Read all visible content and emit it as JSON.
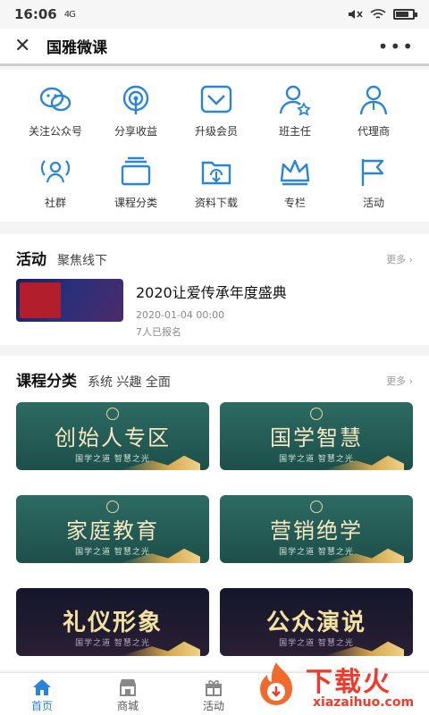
{
  "status": {
    "time": "16:06",
    "signal": "4G"
  },
  "navbar": {
    "title": "国雅微课"
  },
  "grid": [
    {
      "label": "关注公众号",
      "icon": "wechat-icon"
    },
    {
      "label": "分享收益",
      "icon": "broadcast-icon"
    },
    {
      "label": "升级会员",
      "icon": "diamond-icon"
    },
    {
      "label": "班主任",
      "icon": "user-star-icon"
    },
    {
      "label": "代理商",
      "icon": "user-icon"
    },
    {
      "label": "社群",
      "icon": "community-icon"
    },
    {
      "label": "课程分类",
      "icon": "layers-icon"
    },
    {
      "label": "资料下载",
      "icon": "cloud-download-icon"
    },
    {
      "label": "专栏",
      "icon": "crown-icon"
    },
    {
      "label": "活动",
      "icon": "flag-icon"
    }
  ],
  "activity": {
    "title": "活动",
    "subtitle": "聚焦线下",
    "more": "更多 ›",
    "event": {
      "title": "2020让爱传承年度盛典",
      "date": "2020-01-04 00:00",
      "count": "7人已报名"
    }
  },
  "courses": {
    "title": "课程分类",
    "subtitle": "系统 兴趣 全面",
    "more": "更多 ›",
    "cards": [
      {
        "name": "创始人专区",
        "tag": "国学之道 智慧之光",
        "style": "green"
      },
      {
        "name": "国学智慧",
        "tag": "国学之道 智慧之光",
        "style": "green"
      },
      {
        "name": "家庭教育",
        "tag": "国学之道 智慧之光",
        "style": "green"
      },
      {
        "name": "营销绝学",
        "tag": "国学之道 智慧之光",
        "style": "green"
      },
      {
        "name": "礼仪形象",
        "tag": "国学之道 智慧之光",
        "style": "dark"
      },
      {
        "name": "公众演说",
        "tag": "国学之道 智慧之光",
        "style": "dark"
      }
    ]
  },
  "tabs": [
    {
      "label": "首页",
      "icon": "home-icon",
      "active": true
    },
    {
      "label": "商城",
      "icon": "shop-icon",
      "active": false
    },
    {
      "label": "活动",
      "icon": "gift-icon",
      "active": false
    }
  ],
  "watermark": {
    "text": "下载火",
    "url": "xiazaihuo.com"
  },
  "colors": {
    "accent": "#2a84d8",
    "watermark": "#ef3b2c"
  }
}
